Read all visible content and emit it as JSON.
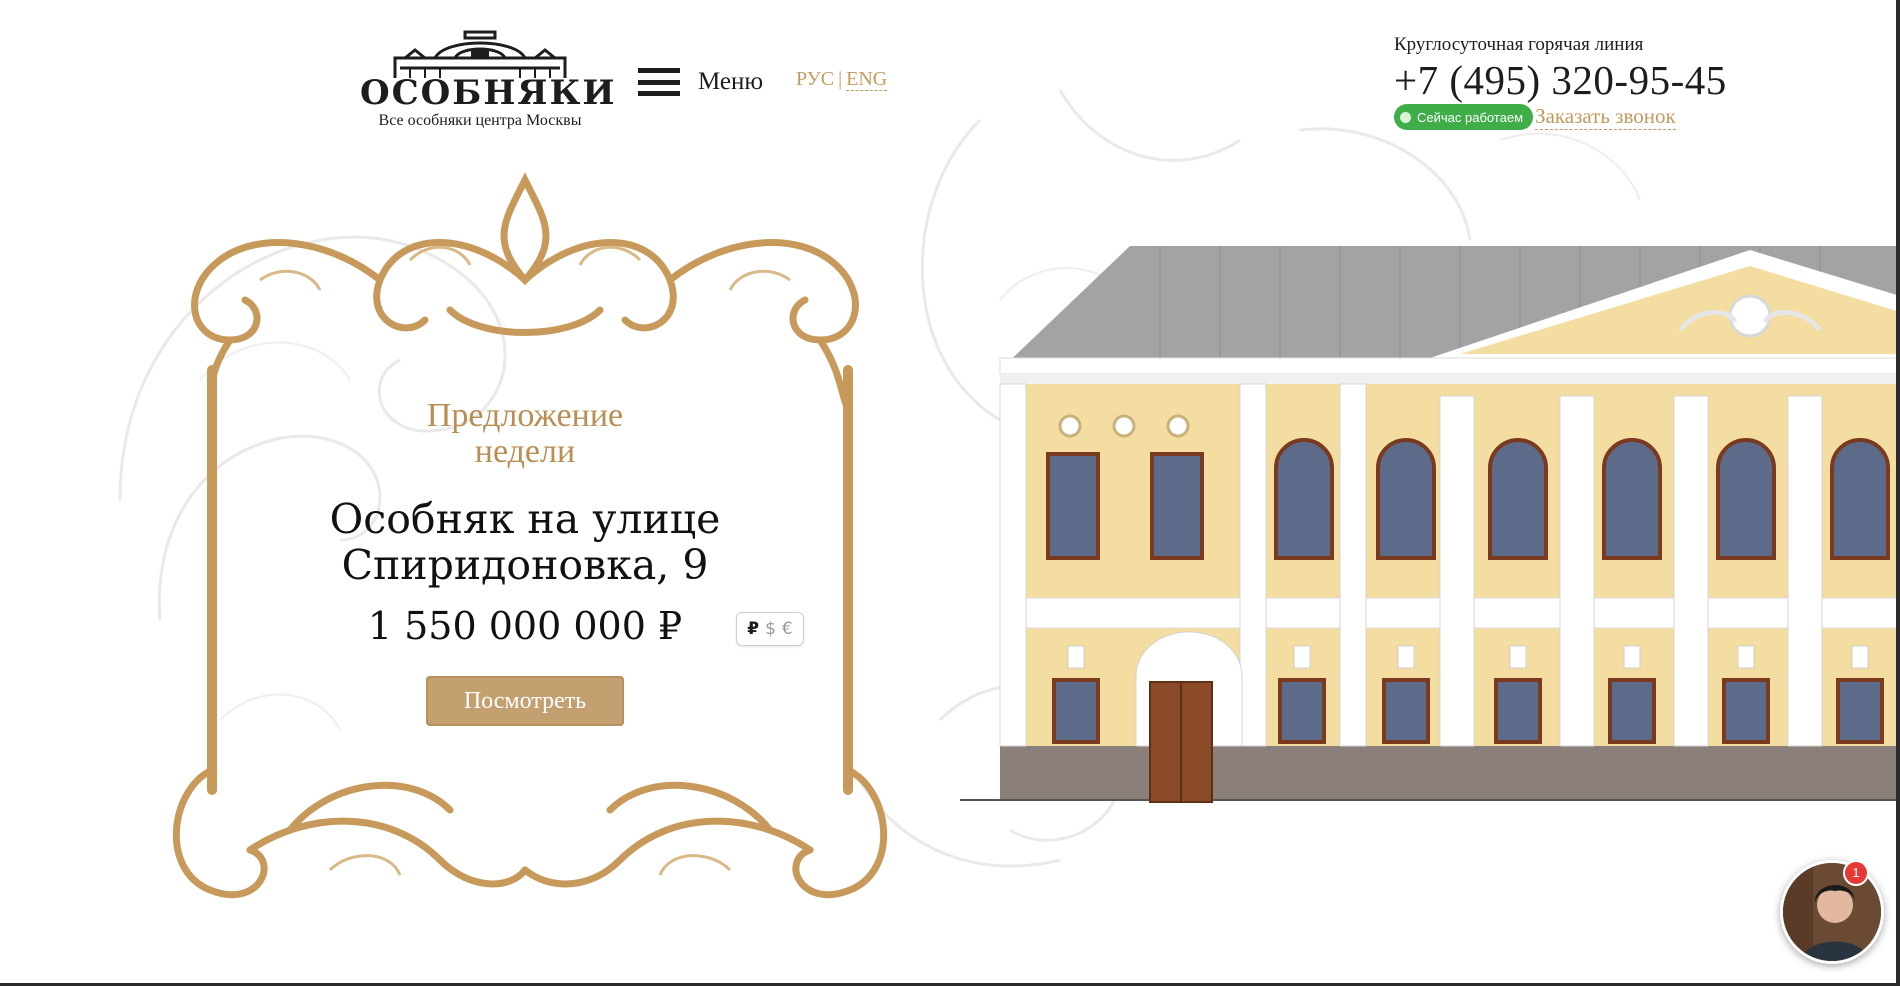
{
  "header": {
    "logo_title": "ОСОБНЯКИ",
    "logo_subtitle": "Все особняки центра Москвы",
    "menu_label": "Меню",
    "lang_active": "РУС",
    "lang_separator": "|",
    "lang_inactive": "ENG",
    "hotline_label": "Круглосуточная горячая линия",
    "hotline_phone": "+7 (495) 320-95-45",
    "status_badge": "Сейчас работаем",
    "callback_link": "Заказать звонок"
  },
  "offer": {
    "kicker": "Предложение недели",
    "title": "Особняк на улице Спиридоновка, 9",
    "price": "1 550 000 000 ₽",
    "currencies": [
      "₽",
      "$",
      "€"
    ],
    "active_currency": "₽",
    "button_label": "Посмотреть"
  },
  "chat": {
    "unread_count": "1",
    "avatar": "consultant-avatar"
  },
  "colors": {
    "accent_gold": "#c39a5e",
    "button_gold": "#c4a070",
    "status_green": "#3fae49",
    "facade_yellow": "#f3dda0",
    "roof_gray": "#9a9a9a",
    "badge_red": "#e53935"
  },
  "icons": {
    "menu": "hamburger-icon",
    "status": "online-dot-icon",
    "logo": "mansion-logo-icon"
  }
}
